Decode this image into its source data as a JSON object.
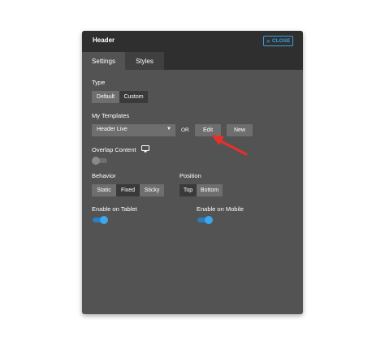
{
  "panel": {
    "title": "Header",
    "close_label": "CLOSE",
    "tabs": [
      {
        "label": "Settings"
      },
      {
        "label": "Styles"
      }
    ]
  },
  "type_section": {
    "label": "Type",
    "options": [
      {
        "label": "Default"
      },
      {
        "label": "Custom"
      }
    ],
    "selected": "Default"
  },
  "templates": {
    "label": "My Templates",
    "selected_value": "Header Live",
    "or_label": "OR",
    "edit_label": "Edit",
    "new_label": "New"
  },
  "overlap": {
    "label": "Overlap Content",
    "enabled": false
  },
  "behavior": {
    "label": "Behavior",
    "options": [
      {
        "label": "Static"
      },
      {
        "label": "Fixed"
      },
      {
        "label": "Sticky"
      }
    ],
    "selected": "Fixed"
  },
  "position": {
    "label": "Position",
    "options": [
      {
        "label": "Top"
      },
      {
        "label": "Bottom"
      }
    ],
    "selected": "Top"
  },
  "tablet": {
    "label": "Enable on Tablet",
    "enabled": true
  },
  "mobile": {
    "label": "Enable on Mobile",
    "enabled": true
  },
  "colors": {
    "accent": "#3ba1e0",
    "panel_bg": "#535353",
    "header_bg": "#2f2f2f",
    "annotation_arrow": "#e8302a"
  },
  "icons": {
    "close": "close-x-icon",
    "dropdown": "chevron-down-icon",
    "overlap_info": "monitor-icon",
    "annotation": "red-arrow-icon"
  }
}
